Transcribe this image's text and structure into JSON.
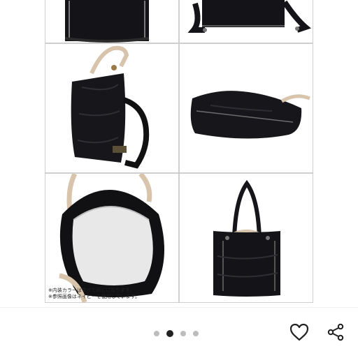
{
  "product_images": [
    {
      "name": "front-view"
    },
    {
      "name": "back-view-straps"
    },
    {
      "name": "side-view"
    },
    {
      "name": "bottom-view"
    },
    {
      "name": "interior-view",
      "note_lines": [
        "※内装カラーはすべて同じになります。",
        "※参照画像はネイビーを使用しています。"
      ]
    },
    {
      "name": "backpack-strap-view"
    }
  ],
  "pager": {
    "total": 4,
    "active_index": 1
  },
  "actions": {
    "like_icon": "heart-icon",
    "share_icon": "share-icon"
  },
  "colors": {
    "accent": "#222222",
    "inactive_dot": "#bdbdbd",
    "bag": "#15151a",
    "leather": "#d9c3aa"
  }
}
